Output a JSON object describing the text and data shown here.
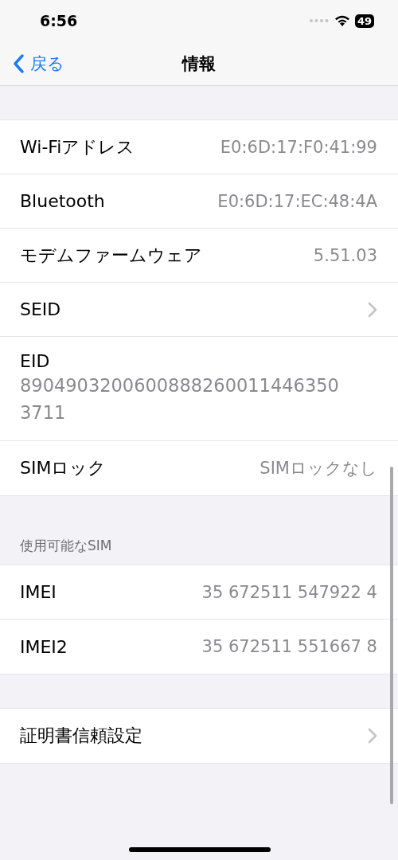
{
  "status_bar": {
    "time": "6:56",
    "battery": "49"
  },
  "nav": {
    "back": "戻る",
    "title": "情報"
  },
  "sections": [
    {
      "rows": [
        {
          "kind": "value",
          "label": "Wi-Fiアドレス",
          "value": "E0:6D:17:F0:41:99"
        },
        {
          "kind": "value",
          "label": "Bluetooth",
          "value": "E0:6D:17:EC:48:4A"
        },
        {
          "kind": "value",
          "label": "モデムファームウェア",
          "value": "5.51.03"
        },
        {
          "kind": "chevron",
          "label": "SEID"
        },
        {
          "kind": "multiline",
          "label": "EID",
          "value": "89049032006008882600114463503711"
        },
        {
          "kind": "value",
          "label": "SIMロック",
          "value": "SIMロックなし"
        }
      ]
    },
    {
      "header": "使用可能なSIM",
      "rows": [
        {
          "kind": "value",
          "label": "IMEI",
          "value": "35 672511 547922 4"
        },
        {
          "kind": "value",
          "label": "IMEI2",
          "value": "35 672511 551667 8"
        }
      ]
    },
    {
      "rows": [
        {
          "kind": "chevron",
          "label": "証明書信頼設定"
        }
      ]
    }
  ]
}
